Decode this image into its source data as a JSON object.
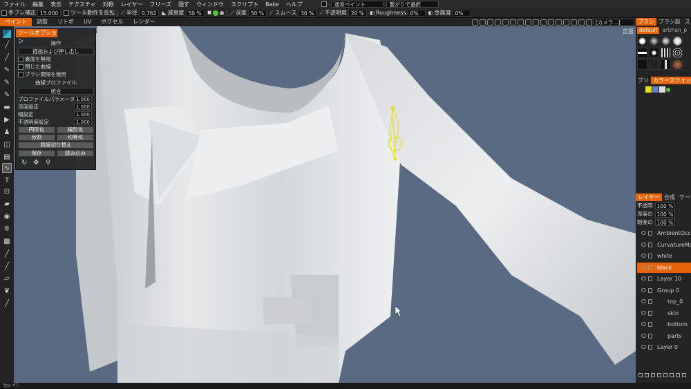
{
  "menu": [
    "ファイル",
    "編集",
    "表示",
    "テクスチャ",
    "対称",
    "レイヤー",
    "フリーズ",
    "隠す",
    "ウィンドウ",
    "スクリプト",
    "Bake",
    "ヘルプ"
  ],
  "menu_right": {
    "paint_mode": "通常ペイント",
    "select_mode": "繋がりで選択"
  },
  "toolopts": {
    "smooth_label": "手ブレ補正",
    "smooth_value": "15.000",
    "reverse_label": "ツール動作を反転",
    "radius_label": "半径",
    "radius_value": "0.762",
    "falloff_label": "減衰度",
    "falloff_value": "50 %",
    "depth_label": "深度",
    "depth_value": "50 %",
    "smooth2_label": "スムース",
    "smooth2_value": "30 %",
    "opacity_label": "不透明度",
    "opacity_value": "20 %",
    "roughness_label": "Roughness",
    "roughness_value": "0%",
    "metal_label": "金属度",
    "metal_value": "0%"
  },
  "modetabs": [
    "ペイント",
    "調整",
    "リトポ",
    "UV",
    "ボクセル",
    "レンダー"
  ],
  "camera": "[カメラ...]",
  "viewport_label": "正面",
  "toolpanel": {
    "title": "ツールオプション",
    "section1": "操作",
    "mode": "描画および押し出し",
    "cb1": "裏面を無視",
    "cb2": "閉じた曲線",
    "cb3": "ブラシ間隔を使用",
    "section2": "曲線プロファイル",
    "merge": "統合",
    "params": [
      {
        "label": "プロファイルパラメータ",
        "value": "1.000"
      },
      {
        "label": "深度設定",
        "value": "1.000"
      },
      {
        "label": "幅設定",
        "value": "1.000"
      },
      {
        "label": "不透明度設定",
        "value": "1.000"
      }
    ],
    "btn_circle": "円形化",
    "btn_linear": "線形化",
    "btn_split": "分割",
    "btn_equal": "均等化",
    "btn_toggle": "鋭度切り替え",
    "btn_save": "保存",
    "btn_load": "読み込み"
  },
  "brush_panel": {
    "tabs": [
      "ブラシ",
      "ブラシ設",
      "ストロ"
    ],
    "preset": "default",
    "preset2": "artman_p"
  },
  "swatch_panel": {
    "tabs": [
      "ブリ",
      "カラースウォッチ"
    ],
    "colors": [
      "#e8e020",
      "#6080c0",
      "#e0e0e0",
      "#5ac23a"
    ]
  },
  "layer_panel": {
    "tabs": [
      "レイヤー",
      "合成",
      "サーフ"
    ],
    "props": [
      {
        "label": "不透明",
        "value": "100 %"
      },
      {
        "label": "深度の",
        "value": "100 %"
      },
      {
        "label": "粗度の",
        "value": "100 %"
      }
    ],
    "layers": [
      {
        "name": "AmbientOcclu",
        "indent": 0
      },
      {
        "name": "CurvatureMap",
        "indent": 0
      },
      {
        "name": "white",
        "indent": 0
      },
      {
        "name": "black",
        "indent": 0,
        "active": true
      },
      {
        "name": "Layer  10",
        "indent": 0
      },
      {
        "name": "Group  0",
        "indent": 0
      },
      {
        "name": "top_0",
        "indent": 1
      },
      {
        "name": "skin",
        "indent": 1
      },
      {
        "name": "bottom",
        "indent": 1
      },
      {
        "name": "parts",
        "indent": 1
      },
      {
        "name": "Layer  0",
        "indent": 0
      }
    ]
  },
  "status": "fps 47;",
  "colors": {
    "accent": "#e8640a",
    "viewport_bg": "#5a6a82"
  }
}
